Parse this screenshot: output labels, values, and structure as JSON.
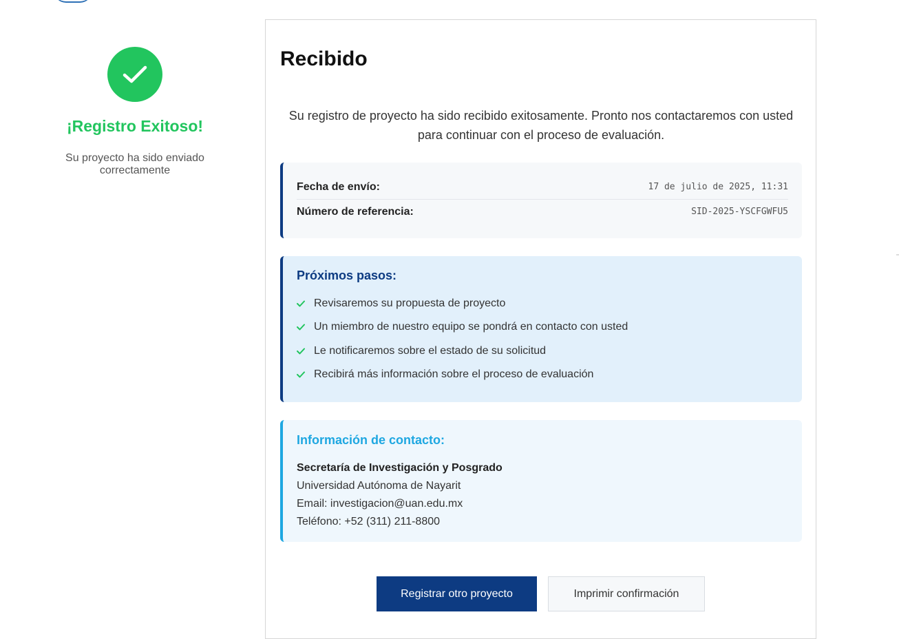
{
  "sidebar": {
    "icon": "check-icon",
    "success_color": "#22c55e",
    "title": "¡Registro Exitoso!",
    "subtitle": "Su proyecto ha sido enviado correctamente"
  },
  "card": {
    "title": "Recibido",
    "intro": "Su registro de proyecto ha sido recibido exitosamente. Pronto nos contactaremos con usted para continuar con el proceso de evaluación.",
    "details": {
      "date_label": "Fecha de envío:",
      "date_value": "17 de julio de 2025, 11:31",
      "ref_label": "Número de referencia:",
      "ref_value": "SID-2025-YSCFGWFU5"
    },
    "next_steps": {
      "title": "Próximos pasos:",
      "items": [
        "Revisaremos su propuesta de proyecto",
        "Un miembro de nuestro equipo se pondrá en contacto con usted",
        "Le notificaremos sobre el estado de su solicitud",
        "Recibirá más información sobre el proceso de evaluación"
      ]
    },
    "contact": {
      "title": "Información de contacto:",
      "organization": "Secretaría de Investigación y Posgrado",
      "university": "Universidad Autónoma de Nayarit",
      "email": "Email: investigacion@uan.edu.mx",
      "phone": "Teléfono: +52 (311) 211-8800"
    },
    "actions": {
      "primary": "Registrar otro proyecto",
      "secondary": "Imprimir confirmación"
    }
  },
  "colors": {
    "primary": "#0d3b82",
    "success": "#22c55e",
    "contact_accent": "#1ea7e1"
  }
}
